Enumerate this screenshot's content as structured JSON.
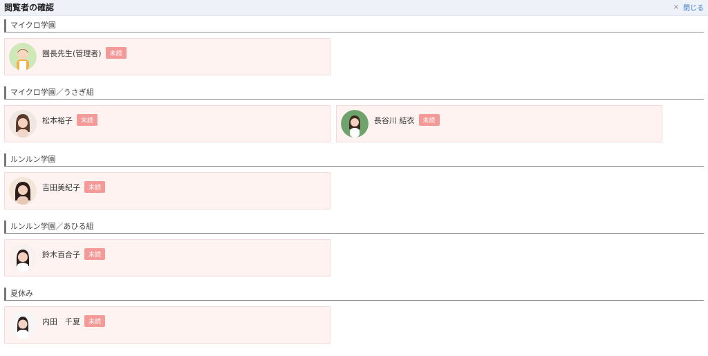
{
  "window": {
    "title": "閲覧者の確認",
    "close_label": "閉じる",
    "close_icon": "×"
  },
  "status_label": "未読",
  "sections": [
    {
      "name": "マイクロ学園",
      "users": [
        {
          "name": "園長先生(管理者)",
          "avatar": "avatar-illustration"
        }
      ]
    },
    {
      "name": "マイクロ学園／うさぎ組",
      "users": [
        {
          "name": "松本裕子",
          "avatar": "avatar-photo"
        },
        {
          "name": "長谷川 結衣",
          "avatar": "avatar-photo"
        }
      ]
    },
    {
      "name": "ルンルン学園",
      "users": [
        {
          "name": "吉田美紀子",
          "avatar": "avatar-photo"
        }
      ]
    },
    {
      "name": "ルンルン学園／あひる組",
      "users": [
        {
          "name": "鈴木百合子",
          "avatar": "avatar-photo"
        }
      ]
    },
    {
      "name": "夏休み",
      "users": [
        {
          "name": "内田　千夏",
          "avatar": "avatar-photo"
        }
      ]
    }
  ]
}
